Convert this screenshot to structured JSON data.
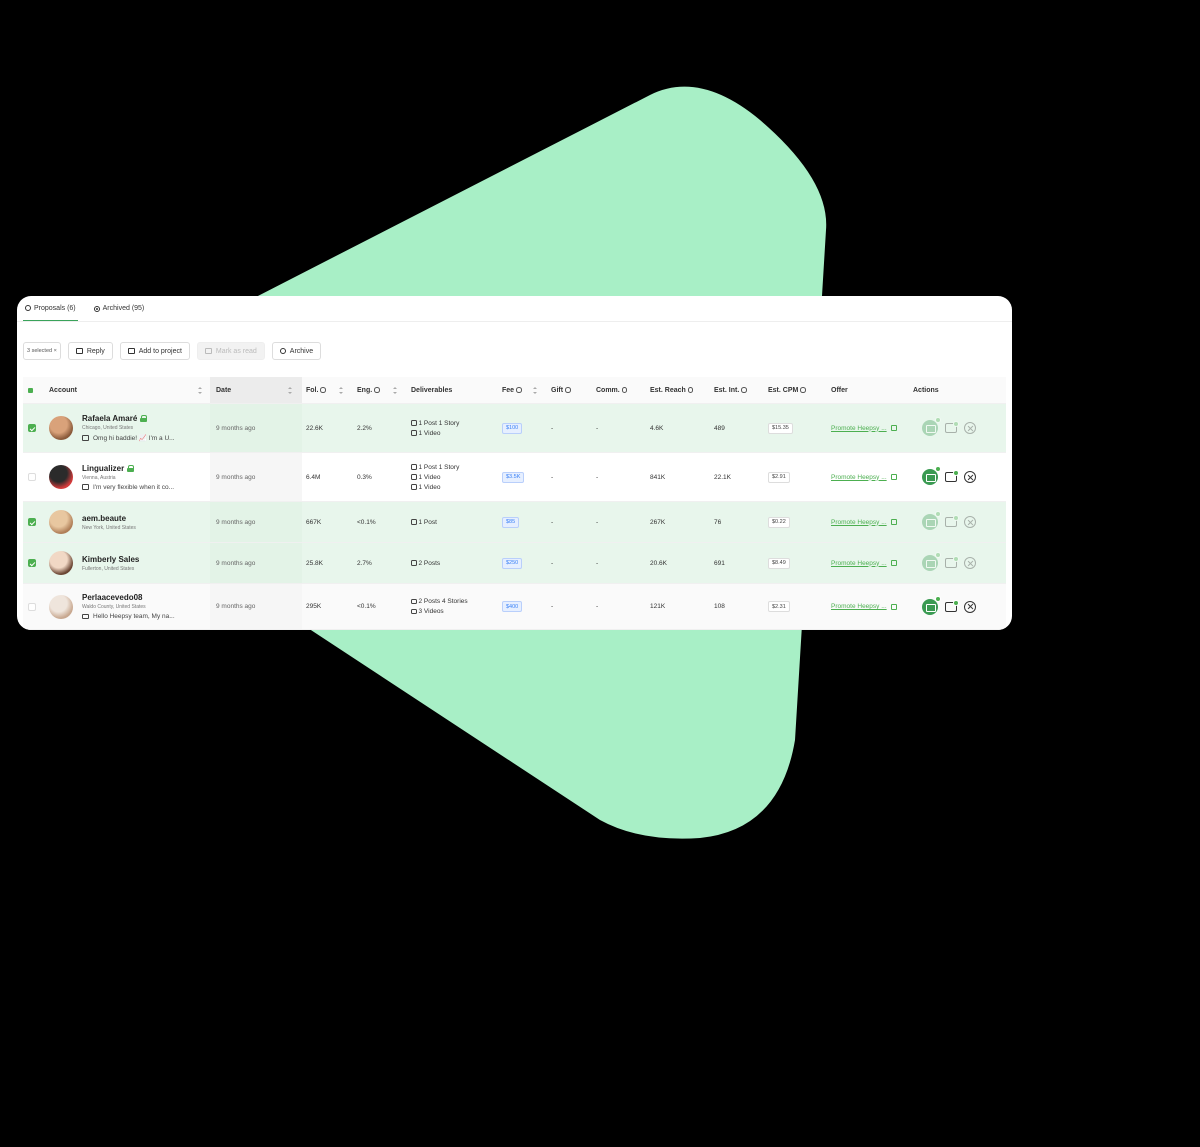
{
  "tabs": [
    {
      "label": "Proposals (6)",
      "active": true,
      "icon": "clock-icon"
    },
    {
      "label": "Archived (95)",
      "active": false,
      "icon": "archive-icon"
    }
  ],
  "toolbar": {
    "selected": "3 selected ×",
    "reply": "Reply",
    "add_to_project": "Add to project",
    "mark_as_read": "Mark as read",
    "archive": "Archive"
  },
  "columns": {
    "account": "Account",
    "date": "Date",
    "fol": "Fol.",
    "eng": "Eng.",
    "deliverables": "Deliverables",
    "fee": "Fee",
    "gift": "Gift",
    "comm": "Comm.",
    "reach": "Est. Reach",
    "int": "Est. Int.",
    "cpm": "Est. CPM",
    "offer": "Offer",
    "actions": "Actions"
  },
  "rows": [
    {
      "name": "Rafaela Amaré",
      "verified": true,
      "location": "Chicago, United States",
      "message": "Omg hi baddie! 📈 I'm a U...",
      "date": "9 months ago",
      "fol": "22.6K",
      "eng": "2.2%",
      "deliverables": [
        "1 Post  1 Story",
        "1 Video"
      ],
      "fee": "$100",
      "gift": "-",
      "comm": "-",
      "reach": "4.6K",
      "int": "489",
      "cpm": "$15.35",
      "offer": "Promote Heepsy ...",
      "selected": true
    },
    {
      "name": "Lingualizer",
      "verified": true,
      "location": "Vienna, Austria",
      "message": "I'm very flexible when it co...",
      "date": "9 months ago",
      "fol": "6.4M",
      "eng": "0.3%",
      "deliverables": [
        "1 Post  1 Story",
        "1 Video",
        "1 Video"
      ],
      "fee": "$3.5K",
      "gift": "-",
      "comm": "-",
      "reach": "841K",
      "int": "22.1K",
      "cpm": "$2.91",
      "offer": "Promote Heepsy ...",
      "selected": false
    },
    {
      "name": "aem.beaute",
      "verified": false,
      "location": "New York, United States",
      "message": "",
      "date": "9 months ago",
      "fol": "667K",
      "eng": "<0.1%",
      "deliverables": [
        "1 Post"
      ],
      "fee": "$85",
      "gift": "-",
      "comm": "-",
      "reach": "267K",
      "int": "76",
      "cpm": "$0.22",
      "offer": "Promote Heepsy ...",
      "selected": true
    },
    {
      "name": "Kimberly Sales",
      "verified": false,
      "location": "Fullerton, United States",
      "message": "",
      "date": "9 months ago",
      "fol": "25.8K",
      "eng": "2.7%",
      "deliverables": [
        "2 Posts"
      ],
      "fee": "$250",
      "gift": "-",
      "comm": "-",
      "reach": "20.6K",
      "int": "691",
      "cpm": "$8.49",
      "offer": "Promote Heepsy ...",
      "selected": true
    },
    {
      "name": "Perlaacevedo08",
      "verified": false,
      "location": "Waldo County, United States",
      "message": "Hello Heepsy team, My na...",
      "date": "9 months ago",
      "fol": "295K",
      "eng": "<0.1%",
      "deliverables": [
        "2 Posts  4 Stories",
        "3 Videos"
      ],
      "fee": "$400",
      "gift": "-",
      "comm": "-",
      "reach": "121K",
      "int": "108",
      "cpm": "$2.31",
      "offer": "Promote Heepsy ...",
      "selected": false
    }
  ],
  "colors": {
    "accent": "#4caf50",
    "shape": "#a8efc6",
    "selected_row": "#e8f6ec"
  }
}
